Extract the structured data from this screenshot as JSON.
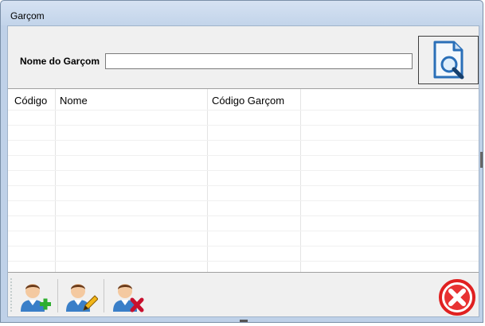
{
  "window": {
    "title": "Garçom"
  },
  "search": {
    "label": "Nome do Garçom",
    "value": "",
    "placeholder": ""
  },
  "grid": {
    "columns": [
      "Código",
      "Nome",
      "Código Garçom"
    ],
    "rows": []
  },
  "toolbar": {
    "buttons": [
      {
        "name": "add-user-button",
        "icon": "user-add-icon"
      },
      {
        "name": "edit-user-button",
        "icon": "user-edit-icon"
      },
      {
        "name": "delete-user-button",
        "icon": "user-delete-icon"
      }
    ],
    "close": {
      "icon": "close-icon",
      "color": "#e02020"
    }
  },
  "colors": {
    "titlebar": "#c8d8ec",
    "accent": "#2a5da8",
    "close": "#e02020"
  }
}
